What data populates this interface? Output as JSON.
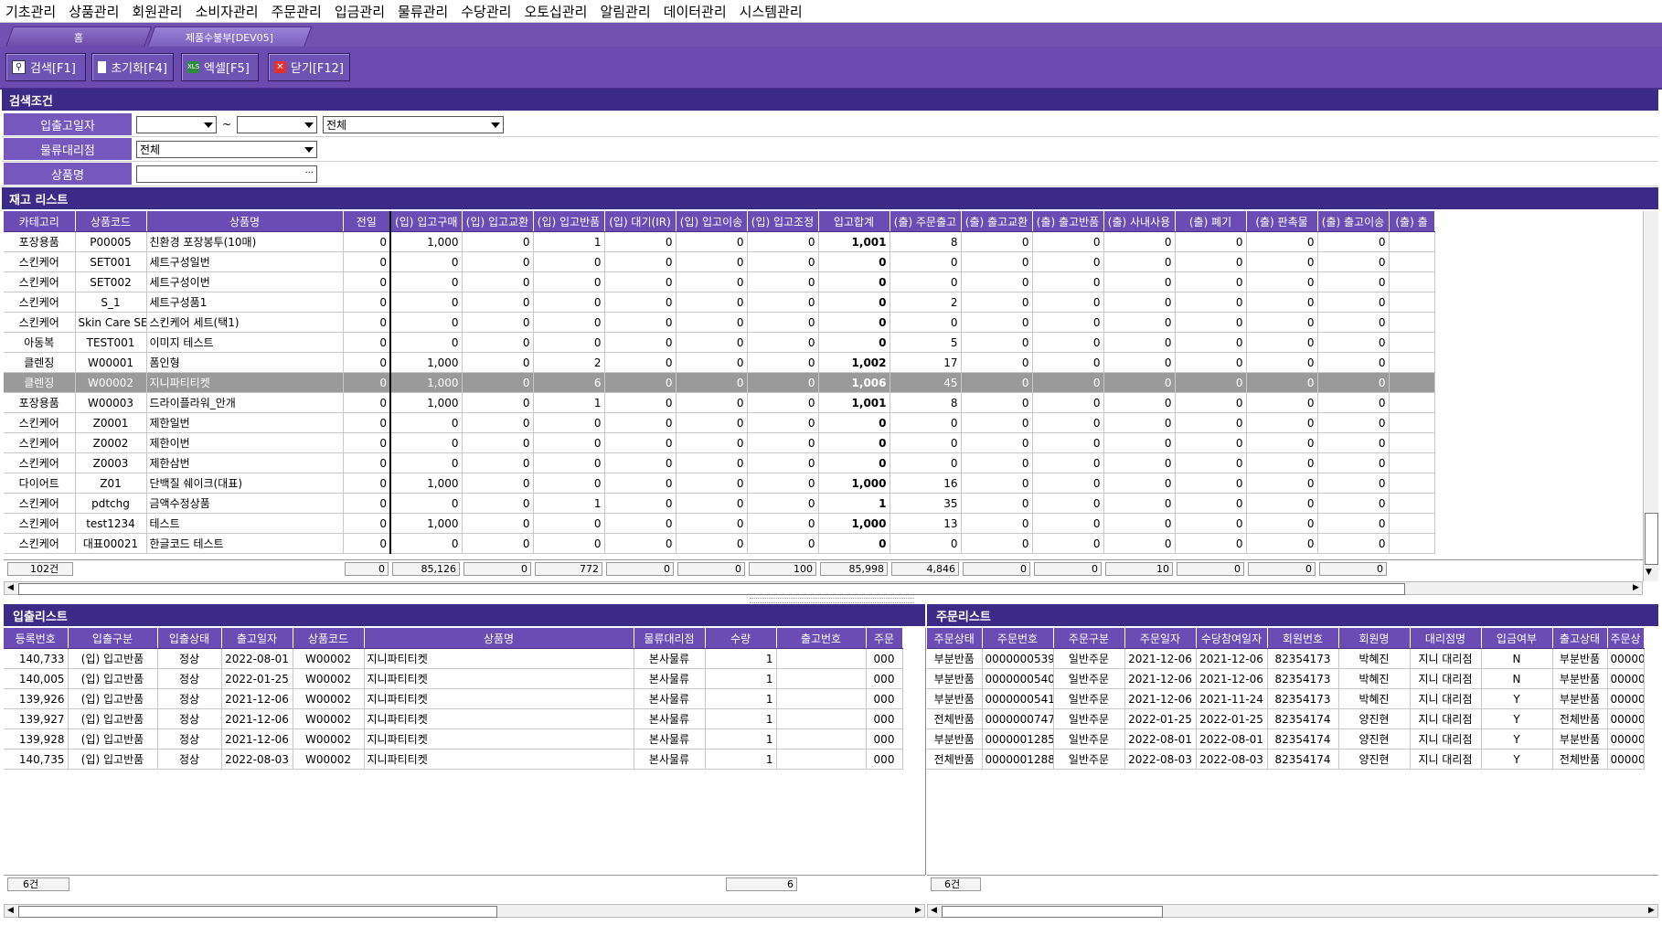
{
  "menu": [
    "기초관리",
    "상품관리",
    "회원관리",
    "소비자관리",
    "주문관리",
    "입금관리",
    "물류관리",
    "수당관리",
    "오토십관리",
    "알림관리",
    "데이터관리",
    "시스템관리"
  ],
  "tabs": {
    "home": "홈",
    "current": "제품수불부[DEV05]"
  },
  "toolbar": {
    "search": "검색[F1]",
    "reset": "초기화[F4]",
    "excel": "엑셀[F5]",
    "close": "닫기[F12]"
  },
  "search": {
    "title": "검색조건",
    "date_label": "입출고일자",
    "tilde": "~",
    "date_from": "",
    "date_to": "",
    "type_value": "전체",
    "branch_label": "물류대리점",
    "branch_value": "전체",
    "product_label": "상품명",
    "product_value": "",
    "dots": "···"
  },
  "stock": {
    "title": "재고 리스트",
    "columns": [
      "카테고리",
      "상품코드",
      "상품명",
      "전일",
      "(입) 입고구매",
      "(입) 입고교환",
      "(입) 입고반품",
      "(입) 대기(IR)",
      "(입) 입고이송",
      "(입) 입고조정",
      "입고합계",
      "(출) 주문출고",
      "(출) 출고교환",
      "(출) 출고반품",
      "(출) 사내사용",
      "(출) 폐기",
      "(출) 판촉물",
      "(출) 출고이송",
      "(출) 출"
    ],
    "rows": [
      [
        "포장용품",
        "P00005",
        "친환경 포장봉투(10매)",
        "0",
        "1,000",
        "0",
        "1",
        "0",
        "0",
        "0",
        "1,001",
        "8",
        "0",
        "0",
        "0",
        "0",
        "0",
        "0"
      ],
      [
        "스킨케어",
        "SET001",
        "세트구성일번",
        "0",
        "0",
        "0",
        "0",
        "0",
        "0",
        "0",
        "0",
        "0",
        "0",
        "0",
        "0",
        "0",
        "0",
        "0"
      ],
      [
        "스킨케어",
        "SET002",
        "세트구성이번",
        "0",
        "0",
        "0",
        "0",
        "0",
        "0",
        "0",
        "0",
        "0",
        "0",
        "0",
        "0",
        "0",
        "0",
        "0"
      ],
      [
        "스킨케어",
        "S_1",
        "세트구성품1",
        "0",
        "0",
        "0",
        "0",
        "0",
        "0",
        "0",
        "0",
        "2",
        "0",
        "0",
        "0",
        "0",
        "0",
        "0"
      ],
      [
        "스킨케어",
        "Skin Care SET",
        "스킨케어 세트(택1)",
        "0",
        "0",
        "0",
        "0",
        "0",
        "0",
        "0",
        "0",
        "0",
        "0",
        "0",
        "0",
        "0",
        "0",
        "0"
      ],
      [
        "아동복",
        "TEST001",
        "이미지 테스트",
        "0",
        "0",
        "0",
        "0",
        "0",
        "0",
        "0",
        "0",
        "5",
        "0",
        "0",
        "0",
        "0",
        "0",
        "0"
      ],
      [
        "클렌징",
        "W00001",
        "폼인형",
        "0",
        "1,000",
        "0",
        "2",
        "0",
        "0",
        "0",
        "1,002",
        "17",
        "0",
        "0",
        "0",
        "0",
        "0",
        "0"
      ],
      [
        "클렌징",
        "W00002",
        "지니파티티켓",
        "0",
        "1,000",
        "0",
        "6",
        "0",
        "0",
        "0",
        "1,006",
        "45",
        "0",
        "0",
        "0",
        "0",
        "0",
        "0"
      ],
      [
        "포장용품",
        "W00003",
        "드라이플라워_안개",
        "0",
        "1,000",
        "0",
        "1",
        "0",
        "0",
        "0",
        "1,001",
        "8",
        "0",
        "0",
        "0",
        "0",
        "0",
        "0"
      ],
      [
        "스킨케어",
        "Z0001",
        "제한일번",
        "0",
        "0",
        "0",
        "0",
        "0",
        "0",
        "0",
        "0",
        "0",
        "0",
        "0",
        "0",
        "0",
        "0",
        "0"
      ],
      [
        "스킨케어",
        "Z0002",
        "제한이번",
        "0",
        "0",
        "0",
        "0",
        "0",
        "0",
        "0",
        "0",
        "0",
        "0",
        "0",
        "0",
        "0",
        "0",
        "0"
      ],
      [
        "스킨케어",
        "Z0003",
        "제한삼번",
        "0",
        "0",
        "0",
        "0",
        "0",
        "0",
        "0",
        "0",
        "0",
        "0",
        "0",
        "0",
        "0",
        "0",
        "0"
      ],
      [
        "다이어트",
        "Z01",
        "단백질 쉐이크(대표)",
        "0",
        "1,000",
        "0",
        "0",
        "0",
        "0",
        "0",
        "1,000",
        "16",
        "0",
        "0",
        "0",
        "0",
        "0",
        "0"
      ],
      [
        "스킨케어",
        "pdtchg",
        "금액수정상품",
        "0",
        "0",
        "0",
        "1",
        "0",
        "0",
        "0",
        "1",
        "35",
        "0",
        "0",
        "0",
        "0",
        "0",
        "0"
      ],
      [
        "스킨케어",
        "test1234",
        "테스트",
        "0",
        "1,000",
        "0",
        "0",
        "0",
        "0",
        "0",
        "1,000",
        "13",
        "0",
        "0",
        "0",
        "0",
        "0",
        "0"
      ],
      [
        "스킨케어",
        "대표00021",
        "한글코드 테스트",
        "0",
        "0",
        "0",
        "0",
        "0",
        "0",
        "0",
        "0",
        "0",
        "0",
        "0",
        "0",
        "0",
        "0",
        "0"
      ]
    ],
    "selected_row": 7,
    "count": "102건",
    "totals": [
      "0",
      "85,126",
      "0",
      "772",
      "0",
      "0",
      "100",
      "85,998",
      "4,846",
      "0",
      "0",
      "10",
      "0",
      "0",
      "0"
    ]
  },
  "io": {
    "title": "입출리스트",
    "columns": [
      "등록번호",
      "입출구분",
      "입출상태",
      "출고일자",
      "상품코드",
      "상품명",
      "물류대리점",
      "수량",
      "출고번호",
      "주문"
    ],
    "rows": [
      [
        "140,733",
        "(입) 입고반품",
        "정상",
        "2022-08-01",
        "W00002",
        "지니파티티켓",
        "본사물류",
        "1",
        "",
        "000"
      ],
      [
        "140,005",
        "(입) 입고반품",
        "정상",
        "2022-01-25",
        "W00002",
        "지니파티티켓",
        "본사물류",
        "1",
        "",
        "000"
      ],
      [
        "139,926",
        "(입) 입고반품",
        "정상",
        "2021-12-06",
        "W00002",
        "지니파티티켓",
        "본사물류",
        "1",
        "",
        "000"
      ],
      [
        "139,927",
        "(입) 입고반품",
        "정상",
        "2021-12-06",
        "W00002",
        "지니파티티켓",
        "본사물류",
        "1",
        "",
        "000"
      ],
      [
        "139,928",
        "(입) 입고반품",
        "정상",
        "2021-12-06",
        "W00002",
        "지니파티티켓",
        "본사물류",
        "1",
        "",
        "000"
      ],
      [
        "140,735",
        "(입) 입고반품",
        "정상",
        "2022-08-03",
        "W00002",
        "지니파티티켓",
        "본사물류",
        "1",
        "",
        "000"
      ]
    ],
    "count": "6건",
    "qty_total": "6"
  },
  "orders": {
    "title": "주문리스트",
    "columns": [
      "주문상태",
      "주문번호",
      "주문구분",
      "주문일자",
      "수당참여일자",
      "회원번호",
      "회원명",
      "대리점명",
      "입금여부",
      "출고상태",
      "주문상"
    ],
    "rows": [
      [
        "부분반품",
        "0000000539",
        "일반주문",
        "2021-12-06",
        "2021-12-06",
        "82354173",
        "박혜진",
        "지니 대리점",
        "N",
        "부분반품",
        "00000"
      ],
      [
        "부분반품",
        "0000000540",
        "일반주문",
        "2021-12-06",
        "2021-12-06",
        "82354173",
        "박혜진",
        "지니 대리점",
        "N",
        "부분반품",
        "00000"
      ],
      [
        "부분반품",
        "0000000541",
        "일반주문",
        "2021-12-06",
        "2021-11-24",
        "82354173",
        "박혜진",
        "지니 대리점",
        "Y",
        "부분반품",
        "00000"
      ],
      [
        "전체반품",
        "0000000747",
        "일반주문",
        "2022-01-25",
        "2022-01-25",
        "82354174",
        "양진현",
        "지니 대리점",
        "Y",
        "전체반품",
        "00000"
      ],
      [
        "부분반품",
        "0000001285",
        "일반주문",
        "2022-08-01",
        "2022-08-01",
        "82354174",
        "양진현",
        "지니 대리점",
        "Y",
        "부분반품",
        "00000"
      ],
      [
        "전체반품",
        "0000001288",
        "일반주문",
        "2022-08-03",
        "2022-08-03",
        "82354174",
        "양진현",
        "지니 대리점",
        "Y",
        "전체반품",
        "00000"
      ]
    ],
    "count": "6건"
  }
}
